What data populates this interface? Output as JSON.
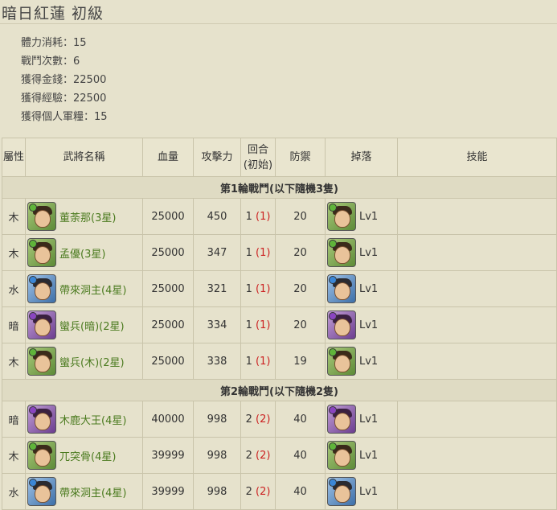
{
  "page": {
    "title": "暗日紅蓮 初級"
  },
  "info": {
    "stamina": "體力消耗：15",
    "battles": "戰鬥次數：6",
    "gold": "獲得金錢：22500",
    "exp": "獲得經驗：22500",
    "merit": "獲得個人軍糧：15"
  },
  "table": {
    "headers": {
      "attr": "屬性",
      "name": "武將名稱",
      "hp": "血量",
      "atk": "攻擊力",
      "turn_a": "回合",
      "turn_b": "(初始)",
      "def": "防禦",
      "drop": "掉落",
      "skill": "技能"
    },
    "rounds": [
      {
        "label": "第1輪戰鬥(以下隨機3隻)",
        "rows": [
          {
            "attr": "木",
            "element": "wood",
            "icon": "general-portrait-icon",
            "name": "董荼那(3星)",
            "hp": "25000",
            "atk": "450",
            "turn": "1",
            "turn_init": "(1)",
            "def": "20",
            "drop": "Lv1",
            "skill": ""
          },
          {
            "attr": "木",
            "element": "wood",
            "icon": "general-portrait-icon",
            "name": "孟優(3星)",
            "hp": "25000",
            "atk": "347",
            "turn": "1",
            "turn_init": "(1)",
            "def": "20",
            "drop": "Lv1",
            "skill": ""
          },
          {
            "attr": "水",
            "element": "water",
            "icon": "general-portrait-icon",
            "name": "帶來洞主(4星)",
            "hp": "25000",
            "atk": "321",
            "turn": "1",
            "turn_init": "(1)",
            "def": "20",
            "drop": "Lv1",
            "skill": ""
          },
          {
            "attr": "暗",
            "element": "dark",
            "icon": "general-portrait-icon",
            "name": "蠻兵(暗)(2星)",
            "hp": "25000",
            "atk": "334",
            "turn": "1",
            "turn_init": "(1)",
            "def": "20",
            "drop": "Lv1",
            "skill": ""
          },
          {
            "attr": "木",
            "element": "wood",
            "icon": "general-portrait-icon",
            "name": "蠻兵(木)(2星)",
            "hp": "25000",
            "atk": "338",
            "turn": "1",
            "turn_init": "(1)",
            "def": "19",
            "drop": "Lv1",
            "skill": ""
          }
        ]
      },
      {
        "label": "第2輪戰鬥(以下隨機2隻)",
        "rows": [
          {
            "attr": "暗",
            "element": "dark",
            "icon": "general-portrait-icon",
            "name": "木鹿大王(4星)",
            "hp": "40000",
            "atk": "998",
            "turn": "2",
            "turn_init": "(2)",
            "def": "40",
            "drop": "Lv1",
            "skill": ""
          },
          {
            "attr": "木",
            "element": "wood",
            "icon": "general-portrait-icon",
            "name": "兀突骨(4星)",
            "hp": "39999",
            "atk": "998",
            "turn": "2",
            "turn_init": "(2)",
            "def": "40",
            "drop": "Lv1",
            "skill": ""
          },
          {
            "attr": "水",
            "element": "water",
            "icon": "general-portrait-icon",
            "name": "帶來洞主(4星)",
            "hp": "39999",
            "atk": "998",
            "turn": "2",
            "turn_init": "(2)",
            "def": "40",
            "drop": "Lv1",
            "skill": ""
          }
        ]
      }
    ]
  },
  "colors": {
    "background": "#e6e2cc",
    "name_link": "#4a7a1e",
    "turn_init": "#cc2222"
  }
}
